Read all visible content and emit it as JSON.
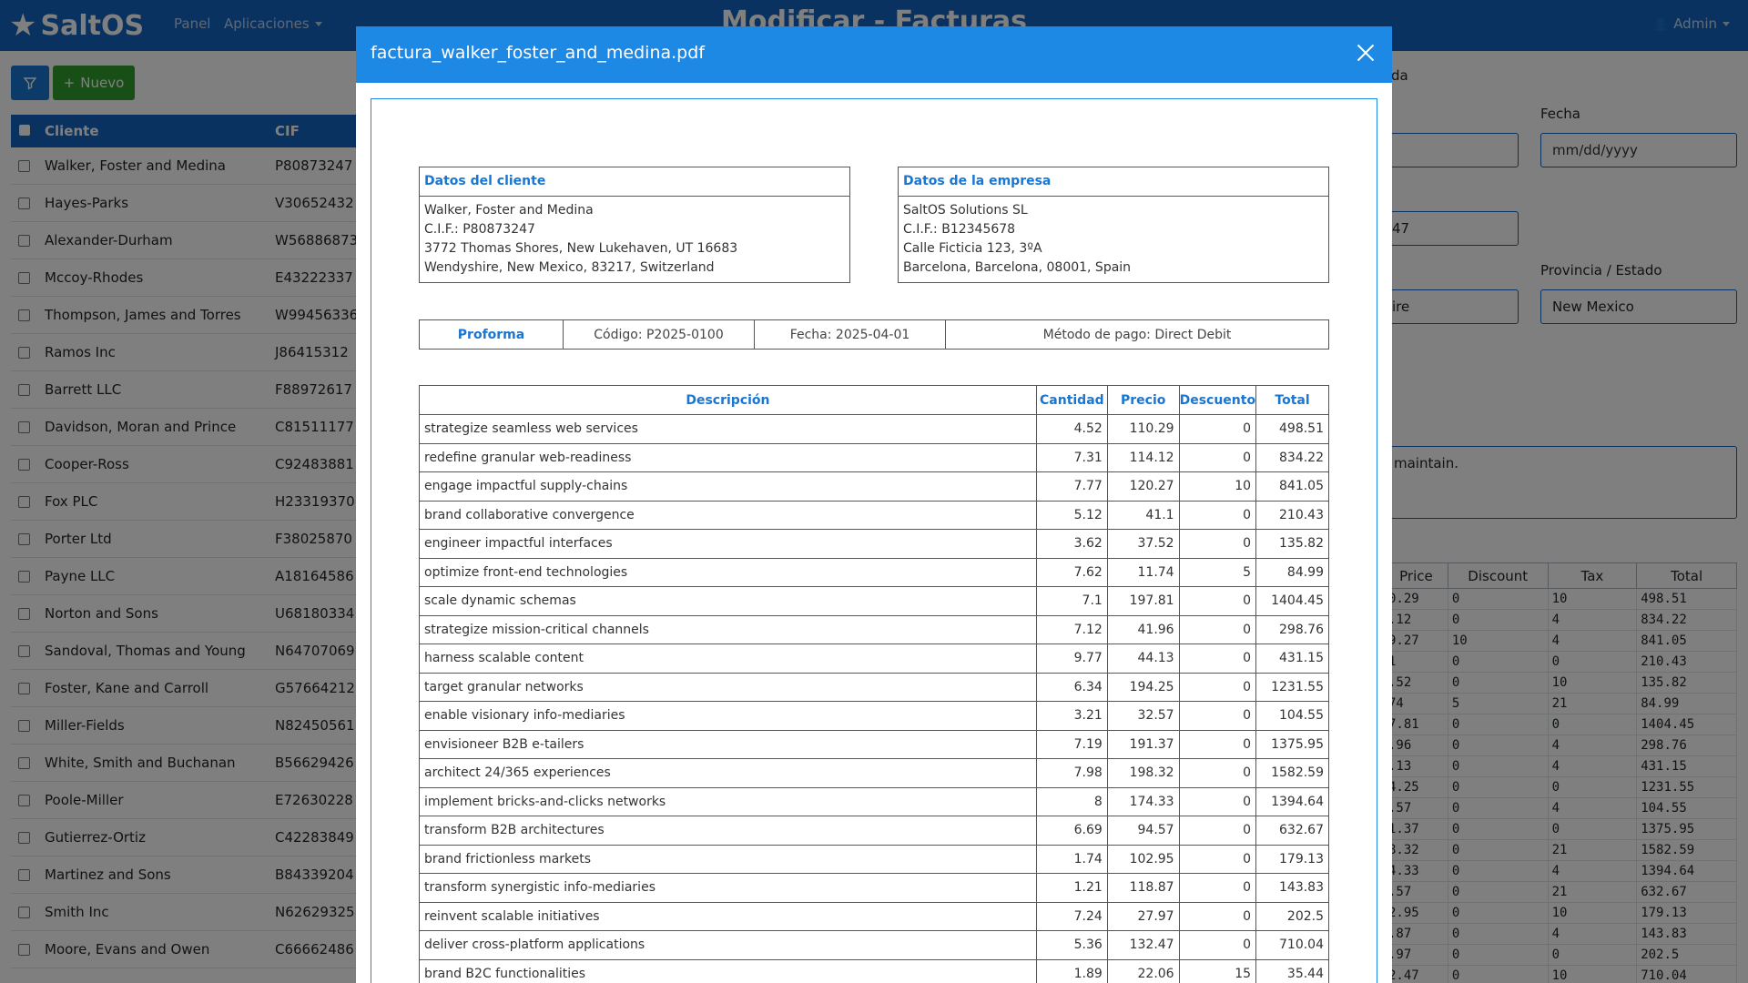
{
  "app": {
    "brand": "SaltOS",
    "nav": {
      "panel": "Panel",
      "apps": "Aplicaciones"
    },
    "page_title": "Modificar - Facturas",
    "user": "Admin"
  },
  "toolbar": {
    "new_label": "Nuevo"
  },
  "list": {
    "headers": {
      "client": "Cliente",
      "cif": "CIF"
    },
    "rows": [
      {
        "client": "Walker, Foster and Medina",
        "cif": "P80873247"
      },
      {
        "client": "Hayes-Parks",
        "cif": "V30652432"
      },
      {
        "client": "Alexander-Durham",
        "cif": "W56886873"
      },
      {
        "client": "Mccoy-Rhodes",
        "cif": "E43222337"
      },
      {
        "client": "Thompson, James and Torres",
        "cif": "W99456336"
      },
      {
        "client": "Ramos Inc",
        "cif": "J86415312"
      },
      {
        "client": "Barrett LLC",
        "cif": "F88972617"
      },
      {
        "client": "Davidson, Moran and Prince",
        "cif": "C81511177"
      },
      {
        "client": "Cooper-Ross",
        "cif": "C92483881"
      },
      {
        "client": "Fox PLC",
        "cif": "H23319370"
      },
      {
        "client": "Porter Ltd",
        "cif": "F38025870"
      },
      {
        "client": "Payne LLC",
        "cif": "A18164586"
      },
      {
        "client": "Norton and Sons",
        "cif": "U68180334"
      },
      {
        "client": "Sandoval, Thomas and Young",
        "cif": "N64707069"
      },
      {
        "client": "Foster, Kane and Carroll",
        "cif": "G57664212"
      },
      {
        "client": "Miller-Fields",
        "cif": "N82450561"
      },
      {
        "client": "White, Smith and Buchanan",
        "cif": "B56629426"
      },
      {
        "client": "Poole-Miller",
        "cif": "E72630228"
      },
      {
        "client": "Gutierrez-Ortiz",
        "cif": "C42283849"
      },
      {
        "client": "Martinez and Sons",
        "cif": "B84339204"
      },
      {
        "client": "Smith Inc",
        "cif": "N62629325"
      },
      {
        "client": "Moore, Evans and Owen",
        "cif": "C66662486"
      }
    ]
  },
  "form": {
    "fragment_top": "da",
    "fecha_label": "Fecha",
    "fecha_placeholder": "mm/dd/yyyy",
    "field2_value": "47",
    "provincia_label": "Provincia / Estado",
    "field3_value": "ire",
    "provincia_value": "New Mexico",
    "notes_value": "maintain."
  },
  "lines": {
    "headers": {
      "price": "Price",
      "discount": "Discount",
      "tax": "Tax",
      "total": "Total"
    },
    "rows": [
      [
        "0.29",
        "0",
        "10",
        "498.51"
      ],
      [
        ".12",
        "0",
        "4",
        "834.22"
      ],
      [
        "9.27",
        "10",
        "4",
        "841.05"
      ],
      [
        "1",
        "0",
        "0",
        "210.43"
      ],
      [
        ".52",
        "0",
        "10",
        "135.82"
      ],
      [
        "74",
        "5",
        "21",
        "84.99"
      ],
      [
        "7.81",
        "0",
        "0",
        "1404.45"
      ],
      [
        ".96",
        "0",
        "4",
        "298.76"
      ],
      [
        ".13",
        "0",
        "4",
        "431.15"
      ],
      [
        "4.25",
        "0",
        "0",
        "1231.55"
      ],
      [
        ".57",
        "0",
        "4",
        "104.55"
      ],
      [
        "1.37",
        "0",
        "0",
        "1375.95"
      ],
      [
        "8.32",
        "0",
        "21",
        "1582.59"
      ],
      [
        "4.33",
        "0",
        "4",
        "1394.64"
      ],
      [
        ".57",
        "0",
        "21",
        "632.67"
      ],
      [
        "2.95",
        "0",
        "10",
        "179.13"
      ],
      [
        ".87",
        "0",
        "4",
        "143.83"
      ],
      [
        ".97",
        "0",
        "0",
        "202.5"
      ],
      [
        "2.47",
        "0",
        "10",
        "710.04"
      ]
    ]
  },
  "modal": {
    "title": "factura_walker_foster_and_medina.pdf",
    "client_box": {
      "title": "Datos del cliente",
      "lines": [
        "Walker, Foster and Medina",
        "C.I.F.: P80873247",
        "3772 Thomas Shores, New Lukehaven, UT 16683",
        "Wendyshire, New Mexico, 83217, Switzerland"
      ]
    },
    "company_box": {
      "title": "Datos de la empresa",
      "lines": [
        "SaltOS Solutions SL",
        "C.I.F.: B12345678",
        "Calle Ficticia 123, 3ºA",
        "Barcelona, Barcelona, 08001, Spain"
      ]
    },
    "meta": {
      "type": "Proforma",
      "code": "Código: P2025-0100",
      "date": "Fecha: 2025-04-01",
      "payment": "Método de pago: Direct Debit"
    },
    "items_headers": {
      "desc": "Descripción",
      "qty": "Cantidad",
      "price": "Precio",
      "discount": "Descuento",
      "total": "Total"
    },
    "items": [
      [
        "strategize seamless web services",
        "4.52",
        "110.29",
        "0",
        "498.51"
      ],
      [
        "redefine granular web-readiness",
        "7.31",
        "114.12",
        "0",
        "834.22"
      ],
      [
        "engage impactful supply-chains",
        "7.77",
        "120.27",
        "10",
        "841.05"
      ],
      [
        "brand collaborative convergence",
        "5.12",
        "41.1",
        "0",
        "210.43"
      ],
      [
        "engineer impactful interfaces",
        "3.62",
        "37.52",
        "0",
        "135.82"
      ],
      [
        "optimize front-end technologies",
        "7.62",
        "11.74",
        "5",
        "84.99"
      ],
      [
        "scale dynamic schemas",
        "7.1",
        "197.81",
        "0",
        "1404.45"
      ],
      [
        "strategize mission-critical channels",
        "7.12",
        "41.96",
        "0",
        "298.76"
      ],
      [
        "harness scalable content",
        "9.77",
        "44.13",
        "0",
        "431.15"
      ],
      [
        "target granular networks",
        "6.34",
        "194.25",
        "0",
        "1231.55"
      ],
      [
        "enable visionary info-mediaries",
        "3.21",
        "32.57",
        "0",
        "104.55"
      ],
      [
        "envisioneer B2B e-tailers",
        "7.19",
        "191.37",
        "0",
        "1375.95"
      ],
      [
        "architect 24/365 experiences",
        "7.98",
        "198.32",
        "0",
        "1582.59"
      ],
      [
        "implement bricks-and-clicks networks",
        "8",
        "174.33",
        "0",
        "1394.64"
      ],
      [
        "transform B2B architectures",
        "6.69",
        "94.57",
        "0",
        "632.67"
      ],
      [
        "brand frictionless markets",
        "1.74",
        "102.95",
        "0",
        "179.13"
      ],
      [
        "transform synergistic info-mediaries",
        "1.21",
        "118.87",
        "0",
        "143.83"
      ],
      [
        "reinvent scalable initiatives",
        "7.24",
        "27.97",
        "0",
        "202.5"
      ],
      [
        "deliver cross-platform applications",
        "5.36",
        "132.47",
        "0",
        "710.04"
      ],
      [
        "brand B2C functionalities",
        "1.89",
        "22.06",
        "15",
        "35.44"
      ]
    ]
  },
  "colors": {
    "primary": "#1565c0",
    "success": "#2e9e2e",
    "modal_header": "#1e88e5"
  }
}
